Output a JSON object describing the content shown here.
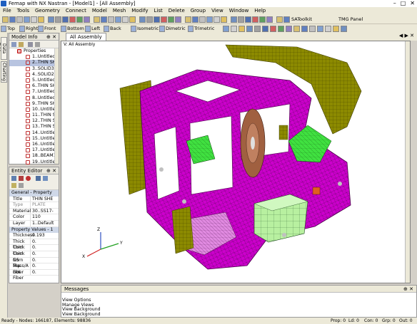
{
  "window": {
    "title": "Femap with NX Nastran - [Model1] - [All Assembly]"
  },
  "menu": [
    "File",
    "Tools",
    "Geometry",
    "Connect",
    "Model",
    "Mesh",
    "Modify",
    "List",
    "Delete",
    "Group",
    "View",
    "Window",
    "Help"
  ],
  "toolbar1": {
    "satoolkit": "SAToolkit",
    "tmg": "TMG Panel"
  },
  "toolbar2": [
    "Top",
    "Right",
    "Front",
    "Bottom",
    "Left",
    "Back",
    "Isometric",
    "Dimetric",
    "Trimetric"
  ],
  "sidetabs": [
    "Data Table",
    "Charting"
  ],
  "model_info": {
    "title": "Model Info",
    "root": "Properties",
    "items": [
      "1..Untitled",
      "2..THIN SH",
      "3..SOLID3",
      "4..SOLID2",
      "5..Untitled",
      "6..THIN SH",
      "7..Untitled",
      "8..Untitled",
      "9..THIN SH",
      "10..Untitlec",
      "11..THIN S",
      "12..THIN S",
      "13..THIN S",
      "14..Untitlec",
      "15..Untitlec",
      "16..Untitlec",
      "17..Untitlec",
      "18..BEAM1",
      "19..Untitlec"
    ]
  },
  "entity_editor": {
    "title": "Entity Editor",
    "section1": "General - Property",
    "rows1": [
      {
        "k": "Title",
        "v": "THIN SHE"
      },
      {
        "k": "Type",
        "v": "PLATE"
      },
      {
        "k": "Material",
        "v": "30..SS17-"
      },
      {
        "k": "Color",
        "v": "110"
      },
      {
        "k": "Layer",
        "v": "1..Default"
      }
    ],
    "section2": "Property Values - 1",
    "rows2": [
      {
        "k": "Thickness",
        "v": "0.193"
      },
      {
        "k": "Thick Corn",
        "v": "0."
      },
      {
        "k": "Thick Corn",
        "v": "0."
      },
      {
        "k": "Thick Corn",
        "v": "0."
      },
      {
        "k": "NS Mass/A",
        "v": "0."
      },
      {
        "k": "Top Fiber",
        "v": "0."
      },
      {
        "k": "Bot Fiber",
        "v": "0."
      }
    ]
  },
  "view": {
    "tab": "All Assembly",
    "label": "V: All Assembly",
    "axes": {
      "x": "X",
      "y": "Y",
      "z": "Z"
    }
  },
  "messages": {
    "title": "Messages",
    "lines": [
      "View Options",
      "Manage Views",
      "View Background",
      "View Background"
    ]
  },
  "status": {
    "left": "Ready - Nodes: 166187, Elements: 98836",
    "prop": "Prop: 0",
    "ld": "Ld: 0",
    "con": "Con: 0",
    "grp": "Grp: 0",
    "out": "Out: 0"
  },
  "colors": {
    "mesh_magenta": "#cc00cc",
    "mesh_olive": "#8c8a00",
    "mesh_green": "#40e040",
    "mesh_light_green": "#b8f0a0",
    "mesh_brown": "#a06040",
    "accent": "#3a6ea5"
  }
}
